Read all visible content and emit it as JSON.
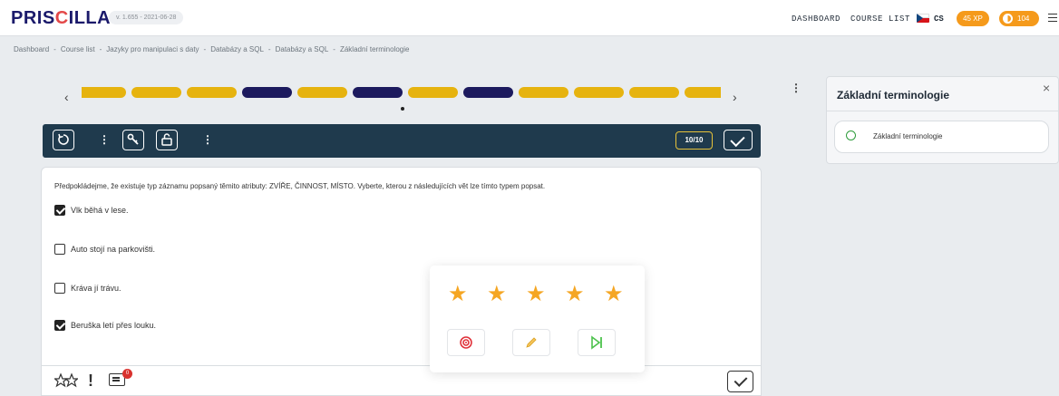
{
  "app": {
    "logo_prefix": "PRIS",
    "logo_c": "C",
    "logo_suffix": "ILLA",
    "version": "v. 1.655 - 2021-06-28"
  },
  "nav": {
    "dashboard": "DASHBOARD",
    "course_list": "COURSE LIST",
    "language": "CS",
    "xp": "45 XP",
    "coins": "104"
  },
  "breadcrumb": [
    "Dashboard",
    "Course list",
    "Jazyky pro manipulaci s daty",
    "Databázy a SQL",
    "Databázy a SQL",
    "Základní terminologie"
  ],
  "breadcrumb_sep": "-",
  "progress": {
    "prev": "‹",
    "next": "›",
    "pills": [
      "done",
      "done",
      "done",
      "current",
      "done",
      "current",
      "done",
      "current",
      "done",
      "done",
      "done",
      "done"
    ],
    "colors": {
      "done": "#e6b30f",
      "current": "#1c1a5e"
    }
  },
  "toolbar": {
    "counter": "10/10"
  },
  "question": {
    "text": "Předpokládejme, že existuje typ záznamu popsaný těmito atributy: ZVÍŘE, ČINNOST, MÍSTO. Vyberte, kterou z následujících vět lze tímto typem popsat.",
    "options": [
      {
        "label": "Vlk běhá v lese.",
        "checked": true
      },
      {
        "label": "Auto stojí na parkovišti.",
        "checked": false
      },
      {
        "label": "Kráva jí trávu.",
        "checked": false
      },
      {
        "label": "Beruška letí přes louku.",
        "checked": true
      }
    ]
  },
  "footer": {
    "comment_count": "0"
  },
  "panel": {
    "title": "Základní terminologie",
    "close": "×",
    "item_label": "Základní terminologie"
  },
  "rating": {
    "stars": 5,
    "star_glyph": "★"
  },
  "icons": {
    "reset": "reset-icon",
    "key": "key-icon",
    "lock": "unlock-icon",
    "retry": "retry-target-icon",
    "edit": "pencil-icon",
    "next": "skip-next-icon"
  }
}
